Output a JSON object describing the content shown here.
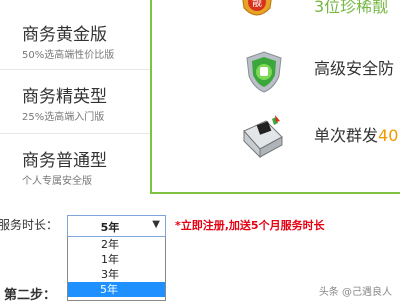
{
  "plans": [
    {
      "name": "商务黄金版",
      "desc": "50%选高端性价比版"
    },
    {
      "name": "商务精英型",
      "desc": "25%选高端入门版"
    },
    {
      "name": "商务普通型",
      "desc": "个人专属安全版"
    }
  ],
  "features": {
    "f1": {
      "text": "3位珍稀靓",
      "icon": "beauty-number-badge-icon",
      "badge_text": "靓"
    },
    "f2": {
      "text": "高级安全防",
      "icon": "security-shield-icon"
    },
    "f3": {
      "text": "单次群发",
      "accent": "40",
      "icon": "mass-mail-icon"
    }
  },
  "duration": {
    "label": "服务时长：",
    "selected": "5年",
    "options": [
      "2年",
      "1年",
      "3年",
      "5年"
    ],
    "promo": "*立即注册,加送5个月服务时长"
  },
  "step": {
    "label": "第二步："
  },
  "watermark": "头条 @己遇良人",
  "colors": {
    "panel_border": "#7fc241",
    "promo_red": "#e60012",
    "select_highlight": "#1e90ff",
    "accent_orange": "#f39800"
  }
}
